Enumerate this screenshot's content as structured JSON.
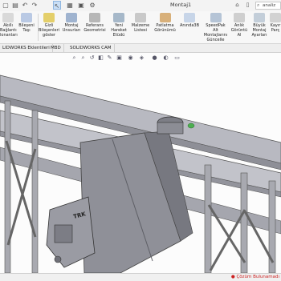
{
  "window": {
    "title": "Montaj1"
  },
  "search": {
    "text": "analiz"
  },
  "ribbon": {
    "items": [
      {
        "label": "Akıllı\nBağlantı\nlonanları"
      },
      {
        "label": "Bileşeni\nTaşı"
      },
      {
        "label": "Gizli\nBileşenleri\ngöster"
      },
      {
        "label": "Montaj\nUnsurları"
      },
      {
        "label": "Referans\nGeometrisi"
      },
      {
        "label": "Yeni\nHareket\nEtüdü"
      },
      {
        "label": "Malzeme\nListesi"
      },
      {
        "label": "Patlatma\nGörünümü"
      },
      {
        "label": "Anında3B"
      },
      {
        "label": "SpeedPak\nAlt\nMontajlarını\nGüncelle"
      },
      {
        "label": "Anlık\nGörüntü\nAl"
      },
      {
        "label": "Büyük\nMontaj\nAyarları"
      },
      {
        "label": "Kayır\nParç"
      }
    ]
  },
  "tabs": [
    {
      "label": "LIDWORKS Eklentileri"
    },
    {
      "label": "MBD"
    },
    {
      "label": "SOLIDWORKS CAM"
    }
  ],
  "model": {
    "brand": "TRK"
  },
  "status": {
    "message": "Çözüm Bulunamadı"
  },
  "colors": {
    "accent": "#c9def5",
    "error": "#cc1f1f",
    "model_gray": "#9a9aa2"
  }
}
